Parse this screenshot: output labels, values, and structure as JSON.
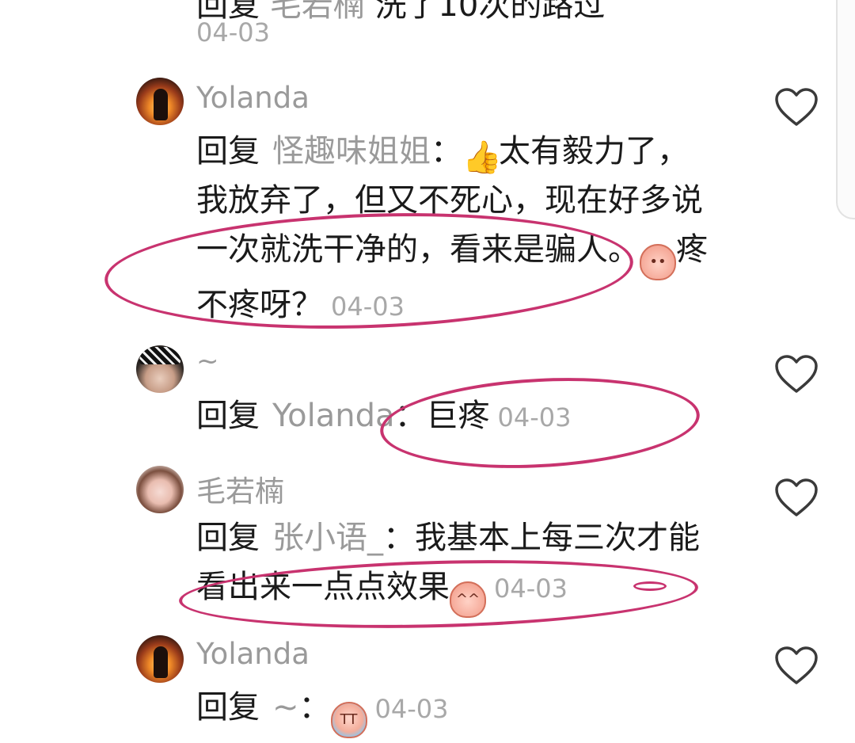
{
  "top_partial": {
    "text_prefix": "回复",
    "target": "毛若楠",
    "text_suffix": "洗了10次的路过",
    "date": "04-03"
  },
  "comments": [
    {
      "name": "Yolanda",
      "reply_word": "回复",
      "target": "怪趣味姐姐",
      "colon": "：",
      "emoji1": "thumbs-up-emoji",
      "text1": "太有毅力了，我放弃了，但又不死心，现在好多说一次就洗干净的，看来是骗人。",
      "emoji2": "peach-face-emoji",
      "text2": "疼不疼呀？",
      "date": "04-03",
      "liked": false
    },
    {
      "name": "~",
      "reply_word": "回复",
      "target": "Yolanda",
      "colon": "：",
      "text1": "巨疼",
      "date": "04-03",
      "liked": false
    },
    {
      "name": "毛若楠",
      "reply_word": "回复",
      "target": "张小语_",
      "colon": "：",
      "text1": "我基本上每三次才能看出来一点点效果",
      "emoji1": "laughing-peach-emoji",
      "date": "04-03",
      "liked": false
    },
    {
      "name": "Yolanda",
      "reply_word": "回复",
      "target": "~",
      "colon": "：",
      "emoji1": "crying-peach-emoji",
      "date": "04-03",
      "liked": false
    }
  ],
  "colors": {
    "annotation_ring": "#c8336f",
    "secondary_text": "#9a9a9a",
    "date_text": "#a8a8a8",
    "heart_stroke": "#3a3a3a"
  }
}
